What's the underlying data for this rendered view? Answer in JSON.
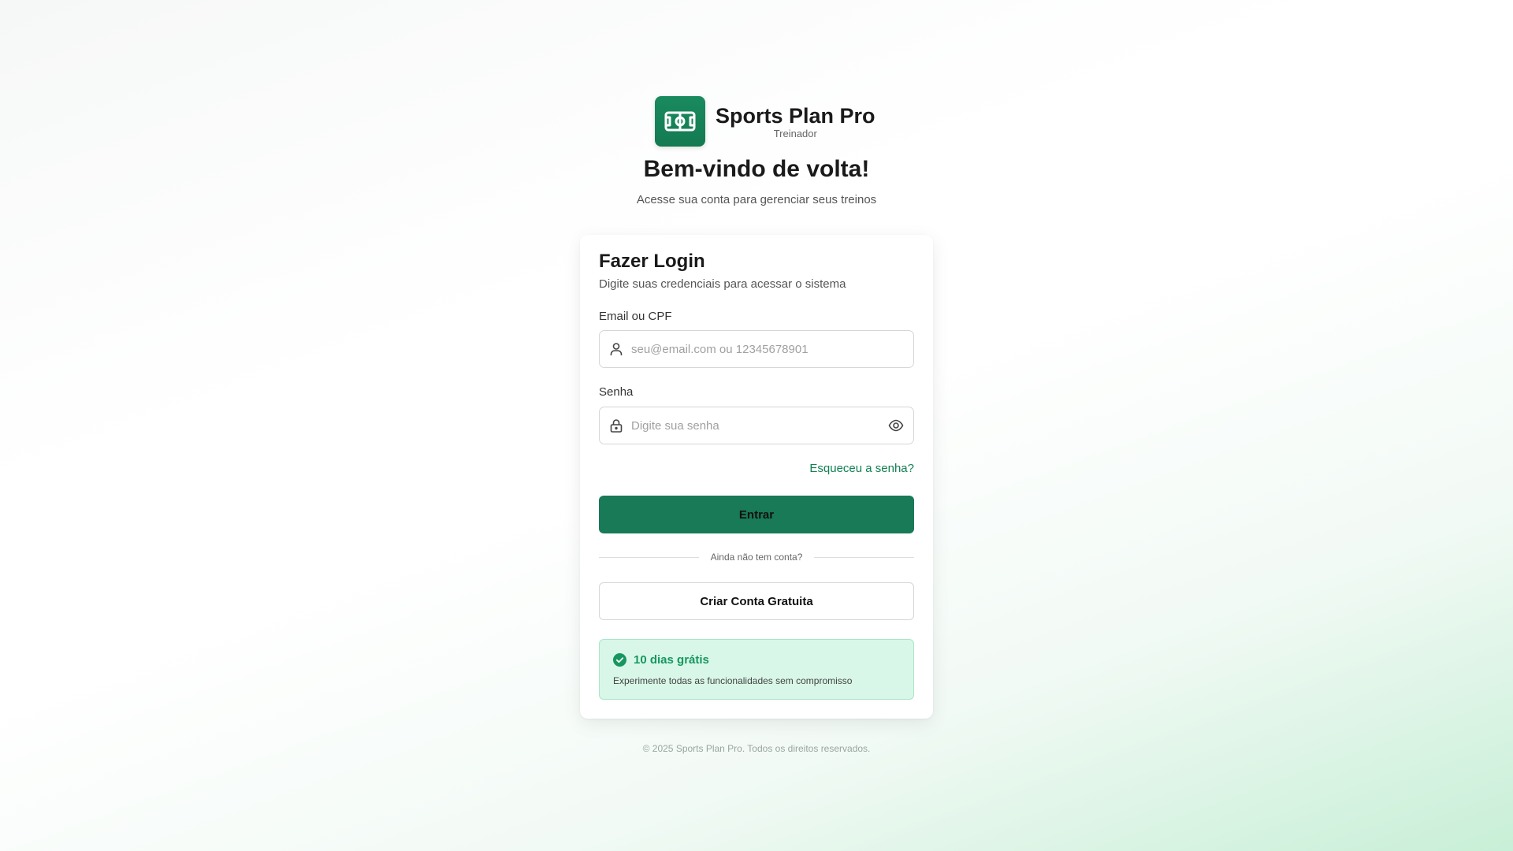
{
  "brand": {
    "title": "Sports Plan Pro",
    "subtitle": "Treinador",
    "logo_icon": "soccer-field-icon",
    "color": "#187a56"
  },
  "welcome": {
    "title": "Bem-vindo de volta!",
    "subtitle": "Acesse sua conta para gerenciar seus treinos"
  },
  "login": {
    "title": "Fazer Login",
    "subtitle": "Digite suas credenciais para acessar o sistema",
    "email": {
      "label": "Email ou CPF",
      "placeholder": "seu@email.com ou 12345678901",
      "value": "",
      "icon": "user-icon"
    },
    "password": {
      "label": "Senha",
      "placeholder": "Digite sua senha",
      "value": "",
      "icon": "lock-icon",
      "toggle_icon": "eye-icon"
    },
    "forgot_link": "Esqueceu a senha?",
    "submit_label": "Entrar",
    "divider_text": "Ainda não tem conta?",
    "signup_label": "Criar Conta Gratuita"
  },
  "promo": {
    "icon": "check-circle-icon",
    "title": "10 dias grátis",
    "description": "Experimente todas as funcionalidades sem compromisso",
    "color": "#16975f"
  },
  "footer": {
    "copyright": "© 2025 Sports Plan Pro. Todos os direitos reservados."
  }
}
